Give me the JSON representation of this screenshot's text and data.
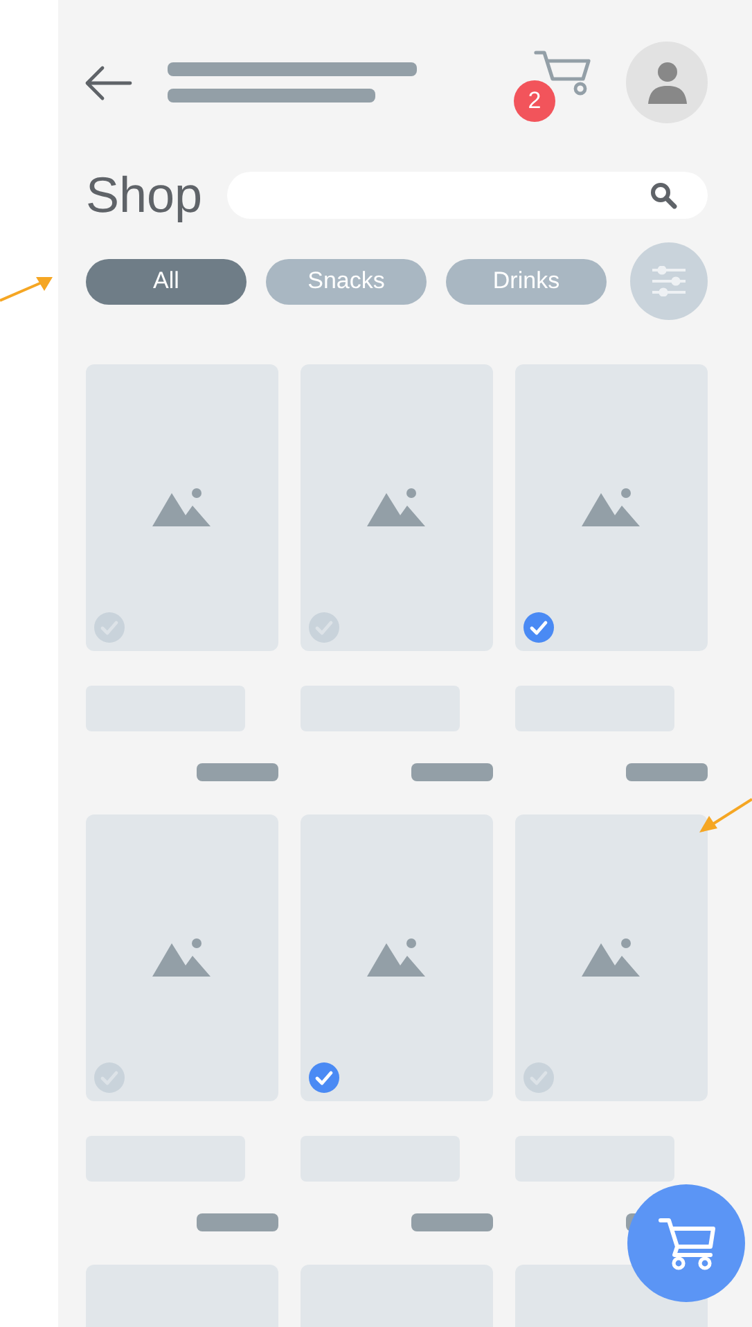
{
  "header": {
    "cart_badge": "2"
  },
  "title": "Shop",
  "chips": [
    {
      "label": "All",
      "selected": true
    },
    {
      "label": "Snacks",
      "selected": false
    },
    {
      "label": "Drinks",
      "selected": false
    }
  ],
  "products": [
    {
      "checked": false
    },
    {
      "checked": false
    },
    {
      "checked": true
    },
    {
      "checked": false
    },
    {
      "checked": true
    },
    {
      "checked": false
    }
  ]
}
